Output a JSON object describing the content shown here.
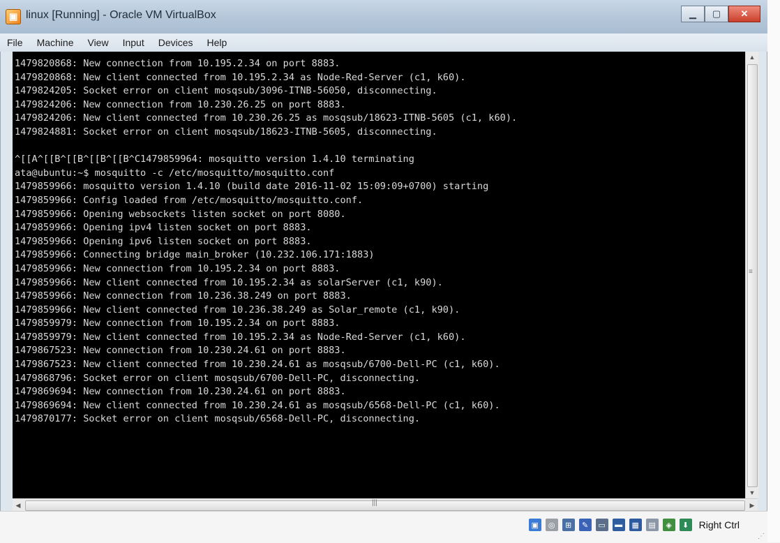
{
  "window": {
    "title": "linux [Running] - Oracle VM VirtualBox",
    "buttons": {
      "minimize": "▁",
      "maximize": "▢",
      "close": "✕"
    }
  },
  "menu": [
    "File",
    "Machine",
    "View",
    "Input",
    "Devices",
    "Help"
  ],
  "console": {
    "lines": [
      "1479820868: New connection from 10.195.2.34 on port 8883.",
      "1479820868: New client connected from 10.195.2.34 as Node-Red-Server (c1, k60).",
      "1479824205: Socket error on client mosqsub/3096-ITNB-56050, disconnecting.",
      "1479824206: New connection from 10.230.26.25 on port 8883.",
      "1479824206: New client connected from 10.230.26.25 as mosqsub/18623-ITNB-5605 (c1, k60).",
      "1479824881: Socket error on client mosqsub/18623-ITNB-5605, disconnecting.",
      "",
      "^[[A^[[B^[[B^[[B^[[B^C1479859964: mosquitto version 1.4.10 terminating",
      "ata@ubuntu:~$ mosquitto -c /etc/mosquitto/mosquitto.conf",
      "1479859966: mosquitto version 1.4.10 (build date 2016-11-02 15:09:09+0700) starting",
      "1479859966: Config loaded from /etc/mosquitto/mosquitto.conf.",
      "1479859966: Opening websockets listen socket on port 8080.",
      "1479859966: Opening ipv4 listen socket on port 8883.",
      "1479859966: Opening ipv6 listen socket on port 8883.",
      "1479859966: Connecting bridge main_broker (10.232.106.171:1883)",
      "1479859966: New connection from 10.195.2.34 on port 8883.",
      "1479859966: New client connected from 10.195.2.34 as solarServer (c1, k90).",
      "1479859966: New connection from 10.236.38.249 on port 8883.",
      "1479859966: New client connected from 10.236.38.249 as Solar_remote (c1, k90).",
      "1479859979: New connection from 10.195.2.34 on port 8883.",
      "1479859979: New client connected from 10.195.2.34 as Node-Red-Server (c1, k60).",
      "1479867523: New connection from 10.230.24.61 on port 8883.",
      "1479867523: New client connected from 10.230.24.61 as mosqsub/6700-Dell-PC (c1, k60).",
      "1479868796: Socket error on client mosqsub/6700-Dell-PC, disconnecting.",
      "1479869694: New connection from 10.230.24.61 on port 8883.",
      "1479869694: New client connected from 10.230.24.61 as mosqsub/6568-Dell-PC (c1, k60).",
      "1479870177: Socket error on client mosqsub/6568-Dell-PC, disconnecting."
    ]
  },
  "statusbar": {
    "host_key": "Right Ctrl",
    "icons": [
      {
        "name": "hard-disk-icon",
        "glyph": "▣",
        "color": "#3a7bd5"
      },
      {
        "name": "optical-drive-icon",
        "glyph": "◎",
        "color": "#9aa0a6"
      },
      {
        "name": "network-icon",
        "glyph": "⊞",
        "color": "#4a6fa5"
      },
      {
        "name": "usb-icon",
        "glyph": "✎",
        "color": "#3a63b8"
      },
      {
        "name": "shared-folders-icon",
        "glyph": "▭",
        "color": "#5b6f8a"
      },
      {
        "name": "display-icon",
        "glyph": "▬",
        "color": "#2f5c9e"
      },
      {
        "name": "video-capture-icon",
        "glyph": "▦",
        "color": "#2d5aa0"
      },
      {
        "name": "cpu-icon",
        "glyph": "▤",
        "color": "#8b97a6"
      },
      {
        "name": "mouse-integration-icon",
        "glyph": "◈",
        "color": "#3f8f3f"
      },
      {
        "name": "keyboard-capture-icon",
        "glyph": "⬇",
        "color": "#2e8b57"
      }
    ]
  }
}
